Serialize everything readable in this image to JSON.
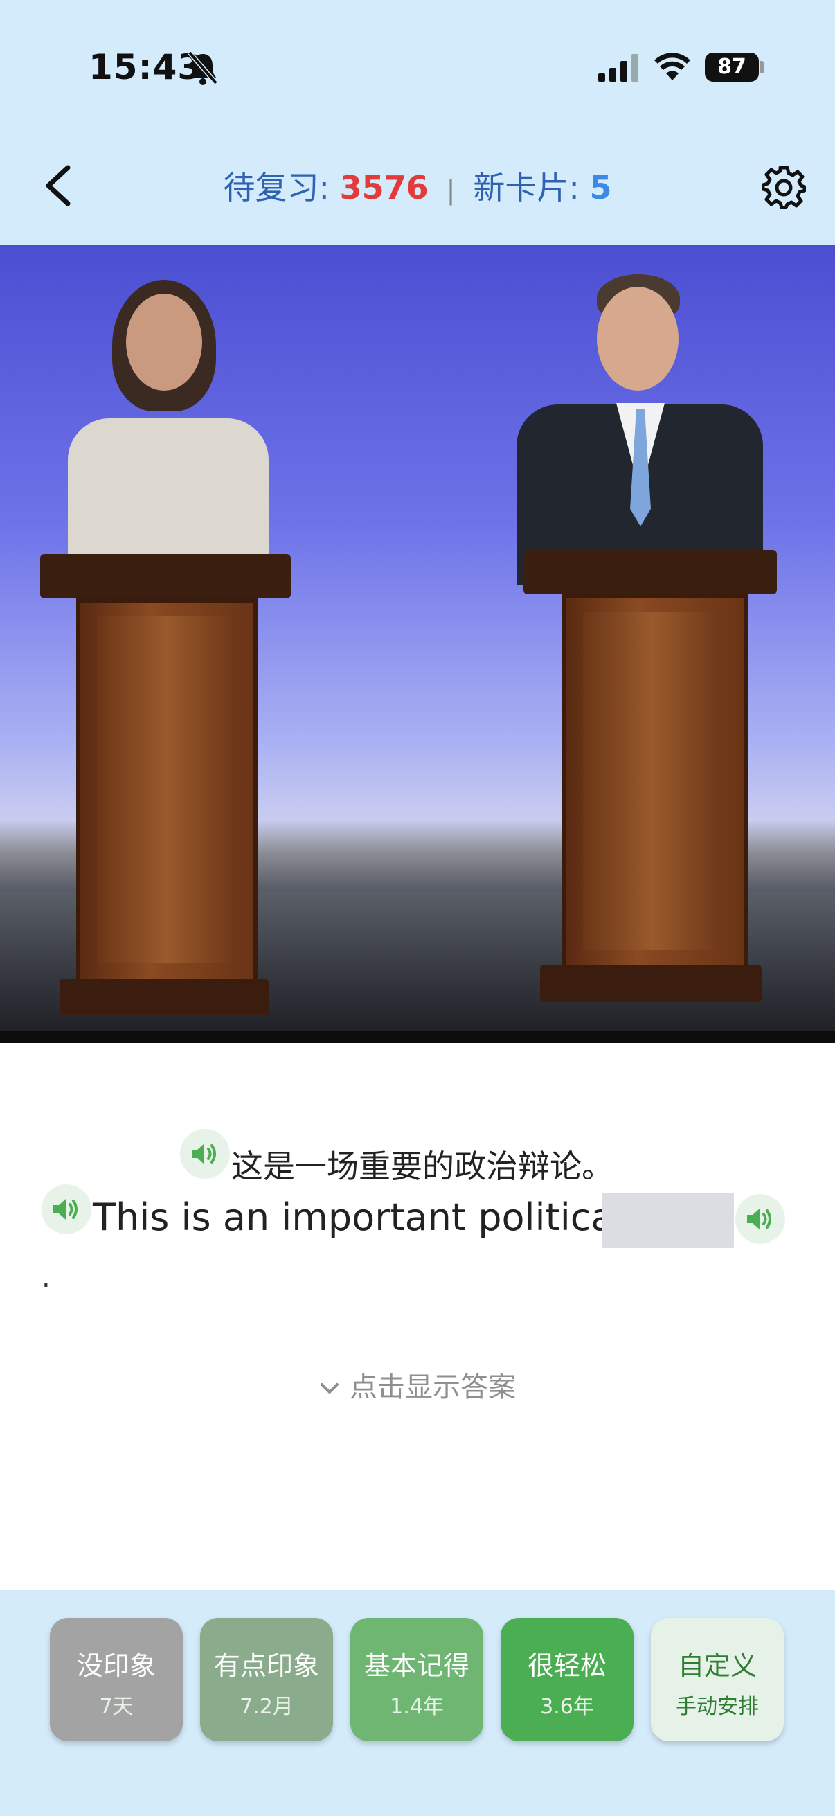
{
  "status_bar": {
    "time": "15:43",
    "battery": "87"
  },
  "header": {
    "review_label": "待复习: ",
    "review_count": "3576",
    "separator": "|",
    "new_label": "新卡片: ",
    "new_count": "5"
  },
  "card": {
    "chinese_sentence": "这是一场重要的政治辩论。",
    "english_sentence": "This is an important political",
    "trailing_punct": ".",
    "reveal_label": "点击显示答案"
  },
  "rating_buttons": [
    {
      "label": "没印象",
      "interval": "7天"
    },
    {
      "label": "有点印象",
      "interval": "7.2月"
    },
    {
      "label": "基本记得",
      "interval": "1.4年"
    },
    {
      "label": "很轻松",
      "interval": "3.6年"
    },
    {
      "label": "自定义",
      "interval": "手动安排"
    }
  ],
  "colors": {
    "header_bg": "#d3ebfb",
    "review_count": "#e33b3b",
    "new_count": "#3b8be6",
    "accent_green": "#4cae53"
  },
  "icons": [
    "bell-slash-icon",
    "signal-icon",
    "wifi-icon",
    "back-chevron-icon",
    "gear-icon",
    "speaker-icon",
    "chevron-down-icon"
  ]
}
